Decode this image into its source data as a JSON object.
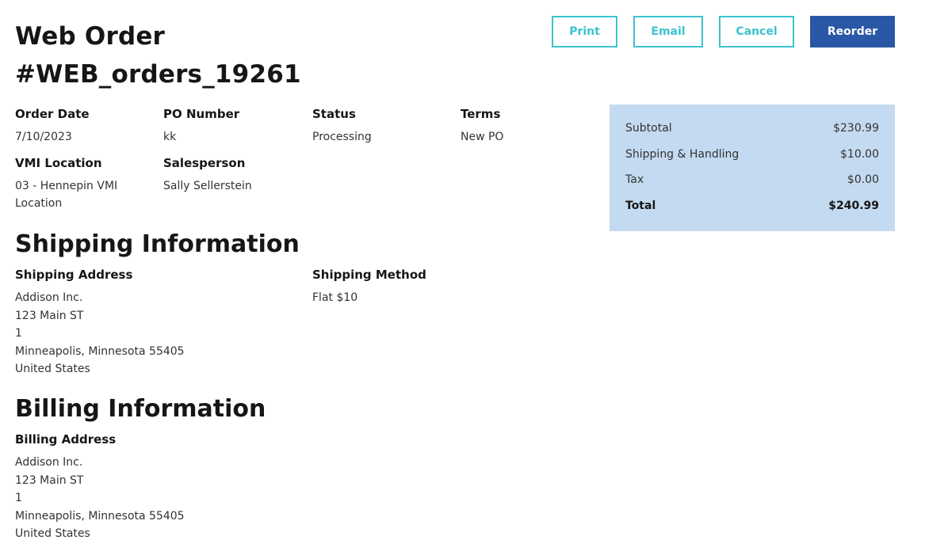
{
  "order": {
    "title_line1": "Web Order",
    "title_line2": "#WEB_orders_19261"
  },
  "actions": {
    "print": "Print",
    "email": "Email",
    "cancel": "Cancel",
    "reorder": "Reorder"
  },
  "details": {
    "order_date": {
      "label": "Order Date",
      "value": "7/10/2023"
    },
    "po_number": {
      "label": "PO Number",
      "value": "kk"
    },
    "status": {
      "label": "Status",
      "value": "Processing"
    },
    "terms": {
      "label": "Terms",
      "value": "New PO"
    },
    "vmi_location": {
      "label": "VMI Location",
      "value": "03 - Hennepin VMI Location"
    },
    "salesperson": {
      "label": "Salesperson",
      "value": "Sally Sellerstein"
    }
  },
  "summary": {
    "subtotal": {
      "label": "Subtotal",
      "value": "$230.99"
    },
    "shipping": {
      "label": "Shipping & Handling",
      "value": "$10.00"
    },
    "tax": {
      "label": "Tax",
      "value": "$0.00"
    },
    "total": {
      "label": "Total",
      "value": "$240.99"
    },
    "background": "#c4daf1"
  },
  "shipping": {
    "title": "Shipping Information",
    "address_label": "Shipping Address",
    "address_lines": [
      "Addison Inc.",
      "123 Main ST",
      "1",
      "Minneapolis, Minnesota 55405",
      "United States"
    ],
    "method_label": "Shipping Method",
    "method_value": "Flat $10"
  },
  "billing": {
    "title": "Billing Information",
    "address_label": "Billing Address",
    "address_lines": [
      "Addison Inc.",
      "123 Main ST",
      "1",
      "Minneapolis, Minnesota 55405",
      "United States"
    ]
  },
  "colors": {
    "outline_button": "#3cc3cf",
    "primary_button": "#2a58a6",
    "summary_background": "#c4daf1"
  }
}
